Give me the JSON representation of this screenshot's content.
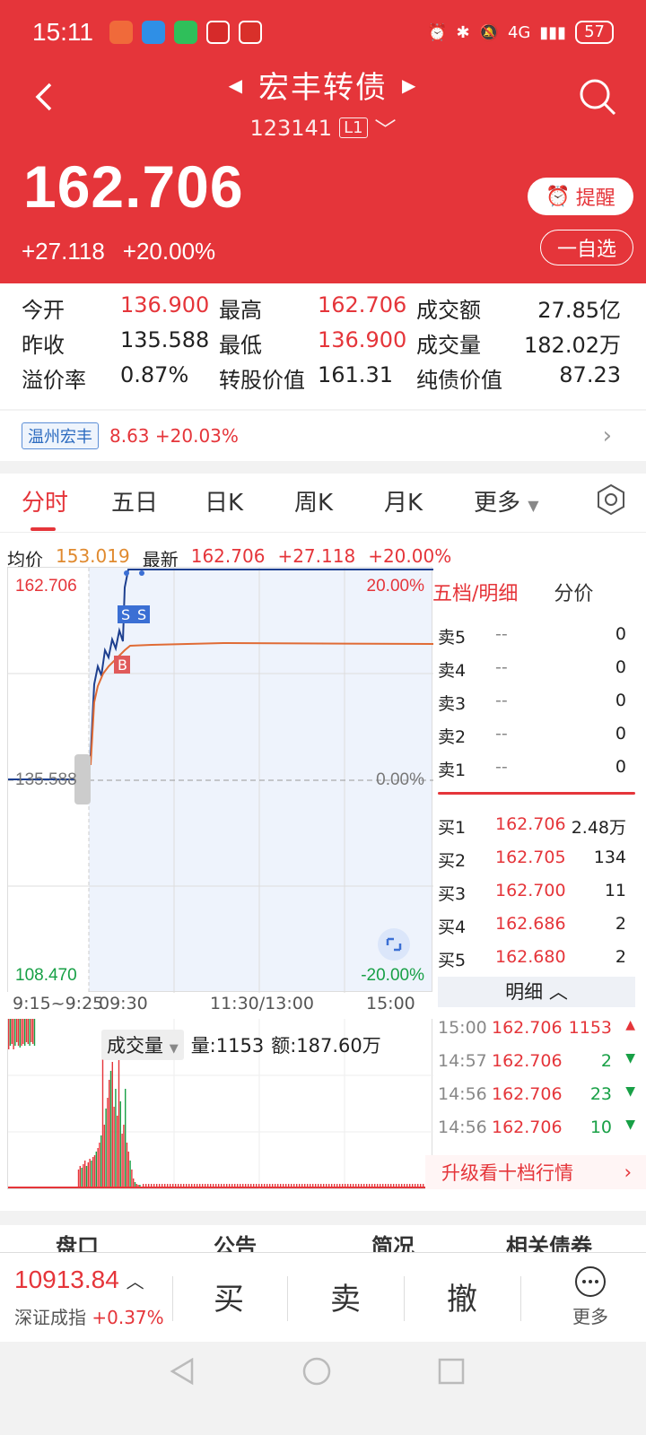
{
  "status": {
    "time": "15:11",
    "network": "4G",
    "battery": "57"
  },
  "header": {
    "title": "宏丰转债",
    "code": "123141",
    "level": "L1"
  },
  "quote": {
    "price": "162.706",
    "change": "+27.118",
    "change_pct": "+20.00%",
    "remind": "提醒",
    "watch": "一自选"
  },
  "stats": [
    [
      {
        "label": "今开",
        "value": "136.900"
      },
      {
        "label": "最高",
        "value": "162.706"
      },
      {
        "label": "成交额",
        "value": "27.85亿"
      }
    ],
    [
      {
        "label": "昨收",
        "value": "135.588"
      },
      {
        "label": "最低",
        "value": "136.900"
      },
      {
        "label": "成交量",
        "value": "182.02万"
      }
    ],
    [
      {
        "label": "溢价率",
        "value": "0.87%"
      },
      {
        "label": "转股价值",
        "value": "161.31"
      },
      {
        "label": "纯债价值",
        "value": "87.23"
      }
    ]
  ],
  "underlying": {
    "name": "温州宏丰",
    "price": "8.63",
    "pct": "+20.03%"
  },
  "tabs": [
    "分时",
    "五日",
    "日K",
    "周K",
    "月K",
    "更多"
  ],
  "avg": {
    "label": "均价",
    "value": "153.019",
    "latest_label": "最新",
    "latest": "162.706",
    "chg": "+27.118",
    "pct": "+20.00%"
  },
  "chart_labels": {
    "top": "162.706",
    "mid": "135.588",
    "bottom": "108.470",
    "top_pct": "20.00%",
    "mid_pct": "0.00%",
    "bottom_pct": "-20.00%"
  },
  "times": [
    "9:15~9:25",
    "09:30",
    "11:30/13:00",
    "15:00"
  ],
  "volume": {
    "tag": "成交量",
    "amount": "量:1153",
    "value": "额:187.60万"
  },
  "orderbook": {
    "title": "五档/明细",
    "alt": "分价",
    "sells": [
      {
        "label": "卖5",
        "price": "--",
        "qty": "0"
      },
      {
        "label": "卖4",
        "price": "--",
        "qty": "0"
      },
      {
        "label": "卖3",
        "price": "--",
        "qty": "0"
      },
      {
        "label": "卖2",
        "price": "--",
        "qty": "0"
      },
      {
        "label": "卖1",
        "price": "--",
        "qty": "0"
      }
    ],
    "buys": [
      {
        "label": "买1",
        "price": "162.706",
        "qty": "2.48万"
      },
      {
        "label": "买2",
        "price": "162.705",
        "qty": "134"
      },
      {
        "label": "买3",
        "price": "162.700",
        "qty": "11"
      },
      {
        "label": "买4",
        "price": "162.686",
        "qty": "2"
      },
      {
        "label": "买5",
        "price": "162.680",
        "qty": "2"
      }
    ],
    "detail": "明细",
    "trades": [
      {
        "time": "15:00",
        "price": "162.706",
        "qty": "1153"
      },
      {
        "time": "14:57",
        "price": "162.706",
        "qty": "2"
      },
      {
        "time": "14:56",
        "price": "162.706",
        "qty": "23"
      },
      {
        "time": "14:56",
        "price": "162.706",
        "qty": "10"
      }
    ],
    "upgrade": "升级看十档行情"
  },
  "bottom_tabs": [
    "盘口",
    "公告",
    "简况",
    "相关债券"
  ],
  "trade_bar": {
    "index_value": "10913.84",
    "index_name": "深证成指",
    "index_pct": "+0.37%",
    "buy": "买",
    "sell": "卖",
    "cancel": "撤",
    "more": "更多"
  }
}
